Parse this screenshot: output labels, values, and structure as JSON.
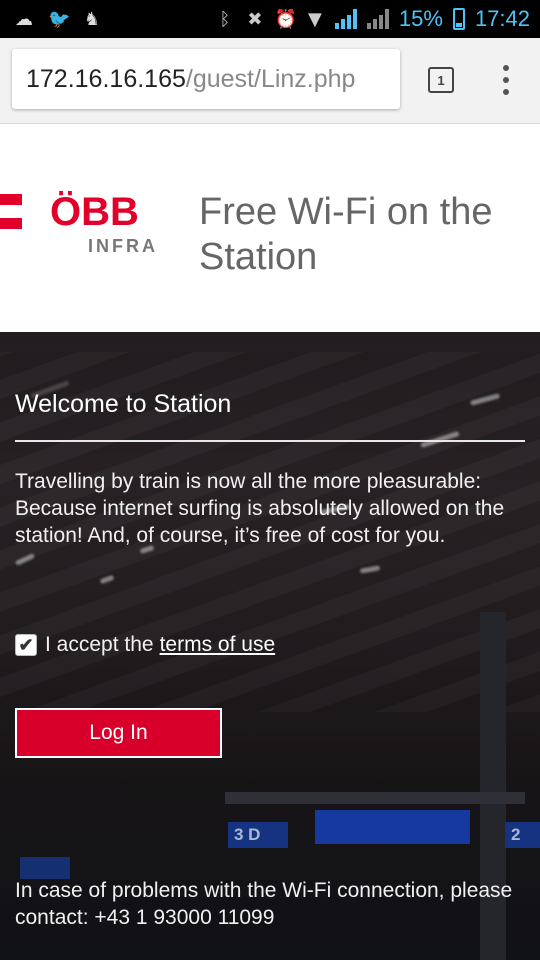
{
  "status_bar": {
    "left_icons": [
      "cloud-icon",
      "twitter-icon",
      "android-icon"
    ],
    "right_icons": [
      "bluetooth-icon",
      "mute-icon",
      "alarm-icon",
      "wifi-icon",
      "signal-icon",
      "signal-icon-no-service",
      "battery-icon"
    ],
    "battery_percent": "15%",
    "time": "17:42",
    "accent": "#4fc3f7"
  },
  "browser": {
    "url_host": "172.16.16.165",
    "url_path": "/guest/Linz.php",
    "tab_count": "1"
  },
  "header": {
    "logo": "ÖBB",
    "logo_sub": "INFRA",
    "title": "Free Wi-Fi on the Station",
    "brand_color": "#e2002a"
  },
  "main": {
    "welcome_title": "Welcome to Station",
    "intro": "Travelling by train is now all the more pleasurable: Because internet surfing is absolutely allowed on the station! And, of course, it’s free of cost for you.",
    "terms_prefix": "I accept the",
    "terms_link": "terms of use",
    "terms_checked": true,
    "login_label": "Log In",
    "contact": "In case of problems with the Wi-Fi connection, please contact: +43 1 93000 11099"
  },
  "background_signs": [
    "3 D",
    "2"
  ]
}
